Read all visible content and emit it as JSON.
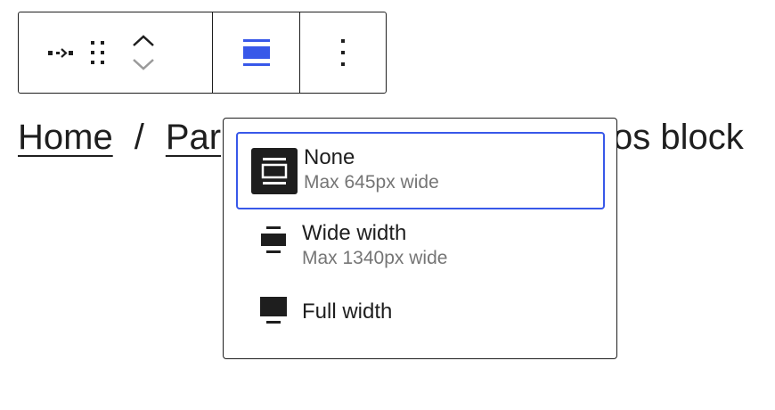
{
  "toolbar": {
    "buttons": [
      {
        "icon": "block-type-icon",
        "label": ""
      },
      {
        "icon": "drag-handle-icon",
        "label": ""
      },
      {
        "icon": "move-up-icon",
        "label": ""
      },
      {
        "icon": "move-down-icon",
        "label": ""
      },
      {
        "icon": "align-none-icon",
        "label": ""
      },
      {
        "icon": "more-options-icon",
        "label": ""
      }
    ],
    "accent_color": "#3858e9"
  },
  "breadcrumb": {
    "items": [
      "Home",
      "Par"
    ],
    "separator": "/",
    "current": "os block"
  },
  "alignment_menu": {
    "options": [
      {
        "label": "None",
        "description": "Max 645px wide",
        "icon": "align-none-icon",
        "selected": true
      },
      {
        "label": "Wide width",
        "description": "Max 1340px wide",
        "icon": "align-wide-icon",
        "selected": false
      },
      {
        "label": "Full width",
        "description": "",
        "icon": "align-full-icon",
        "selected": false
      }
    ]
  }
}
